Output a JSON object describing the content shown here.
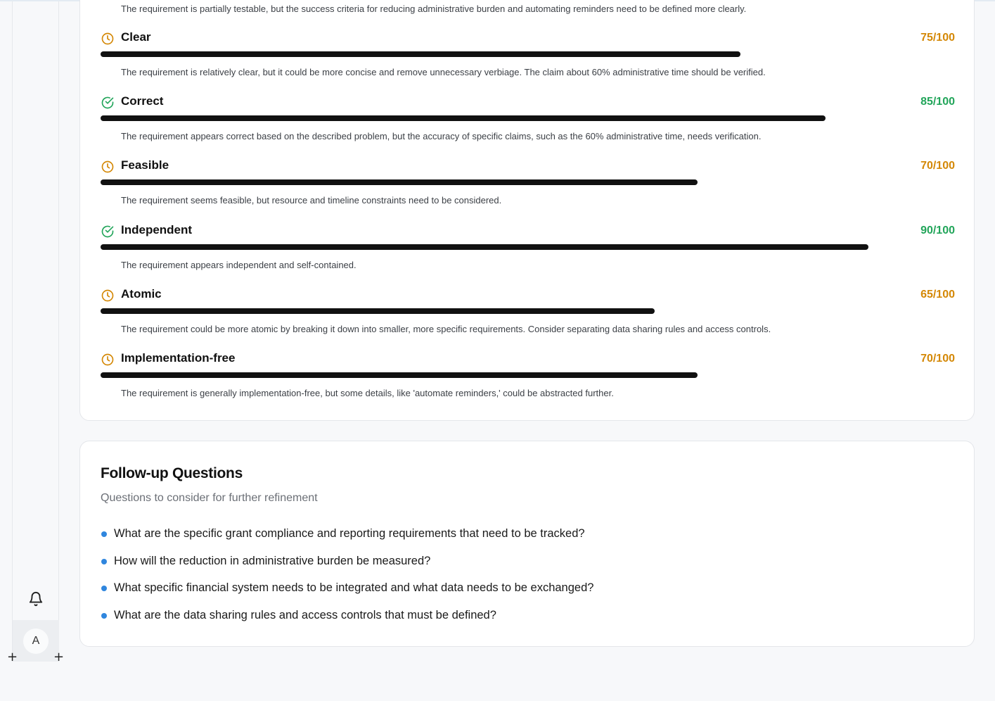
{
  "colors": {
    "pass": "#22a55a",
    "warn": "#d48806",
    "bullet": "#2f86de",
    "bar": "#111111"
  },
  "quality": {
    "intro_text": "The requirement is partially testable, but the success criteria for reducing administrative burden and automating reminders need to be defined more clearly.",
    "criteria": [
      {
        "name": "Clear",
        "score": 75,
        "score_label": "75/100",
        "status": "warning",
        "icon": "clock-icon",
        "description": "The requirement is relatively clear, but it could be more concise and remove unnecessary verbiage. The claim about 60% administrative time should be verified."
      },
      {
        "name": "Correct",
        "score": 85,
        "score_label": "85/100",
        "status": "pass",
        "icon": "check-circle-icon",
        "description": "The requirement appears correct based on the described problem, but the accuracy of specific claims, such as the 60% administrative time, needs verification."
      },
      {
        "name": "Feasible",
        "score": 70,
        "score_label": "70/100",
        "status": "warning",
        "icon": "clock-icon",
        "description": "The requirement seems feasible, but resource and timeline constraints need to be considered."
      },
      {
        "name": "Independent",
        "score": 90,
        "score_label": "90/100",
        "status": "pass",
        "icon": "check-circle-icon",
        "description": "The requirement appears independent and self-contained."
      },
      {
        "name": "Atomic",
        "score": 65,
        "score_label": "65/100",
        "status": "warning",
        "icon": "clock-icon",
        "description": "The requirement could be more atomic by breaking it down into smaller, more specific requirements. Consider separating data sharing rules and access controls."
      },
      {
        "name": "Implementation-free",
        "score": 70,
        "score_label": "70/100",
        "status": "warning",
        "icon": "clock-icon",
        "description": "The requirement is generally implementation-free, but some details, like 'automate reminders,' could be abstracted further."
      }
    ]
  },
  "followup": {
    "title": "Follow-up Questions",
    "subtitle": "Questions to consider for further refinement",
    "questions": [
      "What are the specific grant compliance and reporting requirements that need to be tracked?",
      "How will the reduction in administrative burden be measured?",
      "What specific financial system needs to be integrated and what data needs to be exchanged?",
      "What are the data sharing rules and access controls that must be defined?"
    ]
  },
  "sidebar": {
    "notification_icon": "bell-icon",
    "avatar_initial": "A"
  }
}
